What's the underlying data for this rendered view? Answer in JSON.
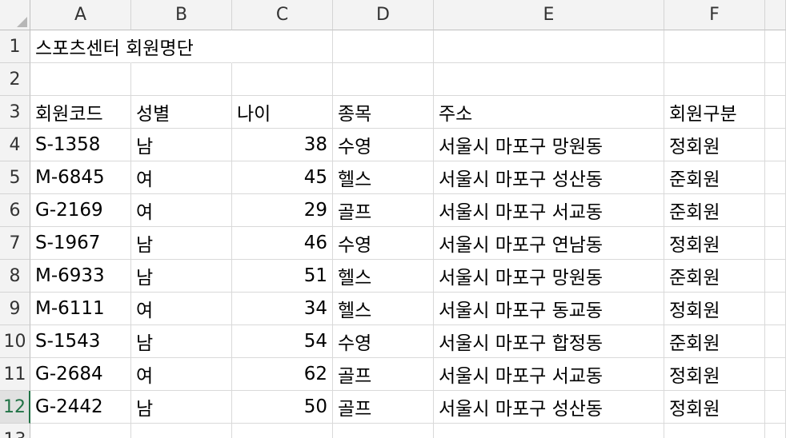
{
  "columns": [
    "A",
    "B",
    "C",
    "D",
    "E",
    "F"
  ],
  "rows": [
    "1",
    "2",
    "3",
    "4",
    "5",
    "6",
    "7",
    "8",
    "9",
    "10",
    "11",
    "12",
    "13"
  ],
  "selected_row": "12",
  "title": "스포츠센터 회원명단",
  "headers": {
    "code": "회원코드",
    "gender": "성별",
    "age": "나이",
    "sport": "종목",
    "address": "주소",
    "type": "회원구분"
  },
  "records": [
    {
      "code": "S-1358",
      "gender": "남",
      "age": "38",
      "sport": "수영",
      "address": "서울시 마포구 망원동",
      "type": "정회원"
    },
    {
      "code": "M-6845",
      "gender": "여",
      "age": "45",
      "sport": "헬스",
      "address": "서울시 마포구 성산동",
      "type": "준회원"
    },
    {
      "code": "G-2169",
      "gender": "여",
      "age": "29",
      "sport": "골프",
      "address": "서울시 마포구 서교동",
      "type": "준회원"
    },
    {
      "code": "S-1967",
      "gender": "남",
      "age": "46",
      "sport": "수영",
      "address": "서울시 마포구 연남동",
      "type": "정회원"
    },
    {
      "code": "M-6933",
      "gender": "남",
      "age": "51",
      "sport": "헬스",
      "address": "서울시 마포구 망원동",
      "type": "준회원"
    },
    {
      "code": "M-6111",
      "gender": "여",
      "age": "34",
      "sport": "헬스",
      "address": "서울시 마포구 동교동",
      "type": "정회원"
    },
    {
      "code": "S-1543",
      "gender": "남",
      "age": "54",
      "sport": "수영",
      "address": "서울시 마포구 합정동",
      "type": "준회원"
    },
    {
      "code": "G-2684",
      "gender": "여",
      "age": "62",
      "sport": "골프",
      "address": "서울시 마포구 서교동",
      "type": "정회원"
    },
    {
      "code": "G-2442",
      "gender": "남",
      "age": "50",
      "sport": "골프",
      "address": "서울시 마포구 성산동",
      "type": "정회원"
    }
  ]
}
